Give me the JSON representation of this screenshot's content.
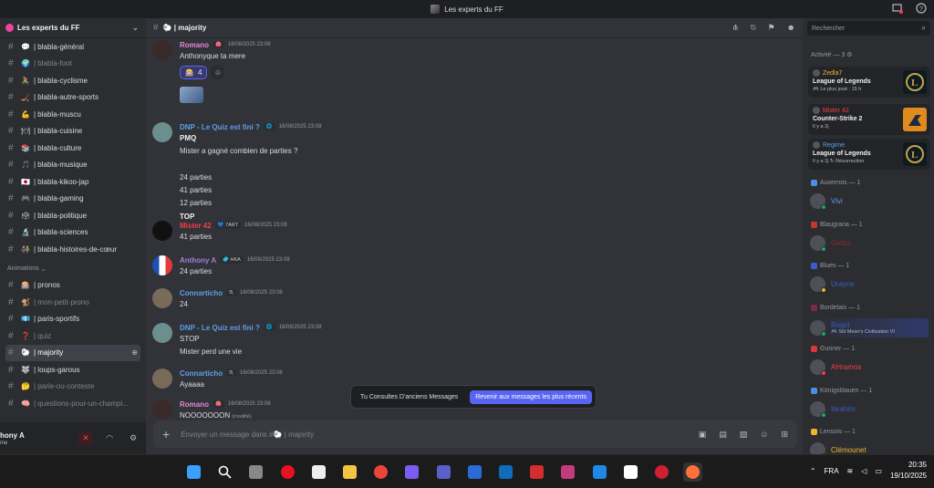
{
  "window": {
    "title": "Les experts du FF"
  },
  "server": {
    "name": "Les experts du FF"
  },
  "channels": [
    {
      "emoji": "💬",
      "name": "| blabla-général",
      "muted": false
    },
    {
      "emoji": "🌍",
      "name": "| blabla-foot",
      "muted": true
    },
    {
      "emoji": "🚴",
      "name": "| blabla-cyclisme",
      "muted": false
    },
    {
      "emoji": "🏒",
      "name": "| blabla-autre-sports",
      "muted": false
    },
    {
      "emoji": "💪",
      "name": "| blabla-muscu",
      "muted": false
    },
    {
      "emoji": "🍽",
      "name": "| blabla-cuisine",
      "muted": false
    },
    {
      "emoji": "📚",
      "name": "| blabla-culture",
      "muted": false
    },
    {
      "emoji": "🎵",
      "name": "| blabla-musique",
      "muted": false
    },
    {
      "emoji": "🇯🇵",
      "name": "| blabla-kikoo-jap",
      "muted": false
    },
    {
      "emoji": "🎮",
      "name": "| blabla-gaming",
      "muted": false
    },
    {
      "emoji": "🗳",
      "name": "| blabla-politique",
      "muted": false
    },
    {
      "emoji": "🔬",
      "name": "| blabla-sciences",
      "muted": false
    },
    {
      "emoji": "👫",
      "name": "| blabla-histoires-de-cœur",
      "muted": false
    }
  ],
  "category": {
    "label": "Animations"
  },
  "anim_channels": [
    {
      "emoji": "🎰",
      "name": "| pronos",
      "muted": false,
      "active": false
    },
    {
      "emoji": "🐒",
      "name": "| mon-petit-prono",
      "muted": true,
      "active": false
    },
    {
      "emoji": "💶",
      "name": "| paris-sportifs",
      "muted": false,
      "active": false
    },
    {
      "emoji": "❓",
      "name": "| quiz",
      "muted": true,
      "active": false
    },
    {
      "emoji": "🐑",
      "name": "| majority",
      "muted": false,
      "active": true
    },
    {
      "emoji": "🐺",
      "name": "| loups-garous",
      "muted": false,
      "active": false
    },
    {
      "emoji": "🤔",
      "name": "| parie-ou-conteste",
      "muted": true,
      "active": false
    },
    {
      "emoji": "🧠",
      "name": "| questions-pour-un-champi...",
      "muted": true,
      "active": false
    }
  ],
  "user": {
    "name": "hony A",
    "status": "me"
  },
  "channel_header": {
    "name": "🐑 | majority"
  },
  "messages": [
    {
      "author": "Romano",
      "color": "#e387d9",
      "tag": "👛",
      "time": "16/08/2025 23:08",
      "lines": [
        "Anthonyque ta mere"
      ],
      "reaction": {
        "emoji": "🎰",
        "count": "4"
      },
      "sticker": true,
      "avatar": "#3a2a2a"
    },
    {
      "author": "DNP - Le Quiz est fini ?",
      "color": "#5d9ee8",
      "tag": "🌐",
      "time": "16/08/2025 23:08",
      "lines": [
        "PMQ",
        "Mister a gagné combien de parties ?",
        "",
        "24 parties",
        "41 parties",
        "12 parties",
        "TOP"
      ],
      "bold": [
        0,
        6
      ],
      "avatar": "#6b8f8f"
    },
    {
      "author": "Mister 42",
      "color": "#f23f43",
      "tag": "💙 7ART",
      "time": "16/08/2025 23:08",
      "lines": [
        "41 parties"
      ],
      "avatar": "#111"
    },
    {
      "author": "Anthony A",
      "color": "#a37ed9",
      "tag": "🥏 HKA",
      "time": "16/08/2025 23:08",
      "lines": [
        "24 parties"
      ],
      "avatar": "#fff"
    },
    {
      "author": "Connarticho",
      "color": "#5d9ee8",
      "tag": "♏",
      "time": "16/08/2025 23:08",
      "lines": [
        "24"
      ],
      "avatar": "#7a6a5a"
    },
    {
      "author": "DNP - Le Quiz est fini ?",
      "color": "#5d9ee8",
      "tag": "🌐",
      "time": "16/08/2025 23:08",
      "lines": [
        "STOP",
        "Mister perd une vie"
      ],
      "avatar": "#6b8f8f"
    },
    {
      "author": "Connarticho",
      "color": "#5d9ee8",
      "tag": "♏",
      "time": "16/08/2025 23:08",
      "lines": [
        "Ayaaaa"
      ],
      "avatar": "#7a6a5a"
    },
    {
      "author": "Romano",
      "color": "#e387d9",
      "tag": "👛",
      "time": "16/08/2025 23:08",
      "lines": [
        "NOOOOOOON"
      ],
      "edited": "(modifié)",
      "avatar": "#3a2a2a"
    }
  ],
  "jump_bar": {
    "text": "Tu Consultes D'anciens Messages",
    "button": "Revenir aux messages les plus récents"
  },
  "composer": {
    "placeholder": "Envoyer un message dans #🐑 | majority"
  },
  "member_list": {
    "search_placeholder": "Rechercher",
    "activity_title": "Activité — 3 ⚙",
    "activities": [
      {
        "user": "Zedla7",
        "color": "#f0b232",
        "game": "League of Legends",
        "sub": "🎮 Le plus joué : 15 h",
        "art": "lol"
      },
      {
        "user": "Mister 42",
        "color": "#f23f43",
        "game": "Counter-Strike 2",
        "sub": "Il y a 2j",
        "art": "cs"
      },
      {
        "user": "Regime",
        "color": "#5d9ee8",
        "game": "League of Legends",
        "sub": "Il y a 2j  ↻ Résurrection",
        "art": "lol"
      }
    ],
    "roles": [
      {
        "name": "Auxerrois — 1",
        "icon": "#4a90e2",
        "member": "Vivi",
        "color": "#5d9ee8",
        "status": "#23a55a"
      },
      {
        "name": "Blaugrana — 1",
        "icon": "#c0392b",
        "member": "Gotbo",
        "color": "#8b2a2a",
        "status": "#23a55a"
      },
      {
        "name": "Blues — 1",
        "icon": "#3b5dc9",
        "member": "Urayne",
        "color": "#3b5dc9",
        "status": "#f0b232"
      },
      {
        "name": "Bordelais — 1",
        "icon": "#7a2a4a",
        "member": "Rogvi",
        "color": "#3b5dc9",
        "status": "#23a55a",
        "sub": "🎮 Sid Meier's Civilization VI"
      },
      {
        "name": "Gunner — 1",
        "icon": "#d9363e",
        "member": "AHramos",
        "color": "#f23f43",
        "status": "#f23f43"
      },
      {
        "name": "Königsblauen — 1",
        "icon": "#4a90e2",
        "member": "Ibrahim",
        "color": "#3b5dc9",
        "status": "#23a55a"
      },
      {
        "name": "Lensois — 1",
        "icon": "#f0b232",
        "member": "Clémounet",
        "color": "#f0b232",
        "status": "#23a55a"
      }
    ]
  },
  "taskbar": {
    "lang": "FRA",
    "time": "20:35",
    "date": "19/10/2025"
  }
}
